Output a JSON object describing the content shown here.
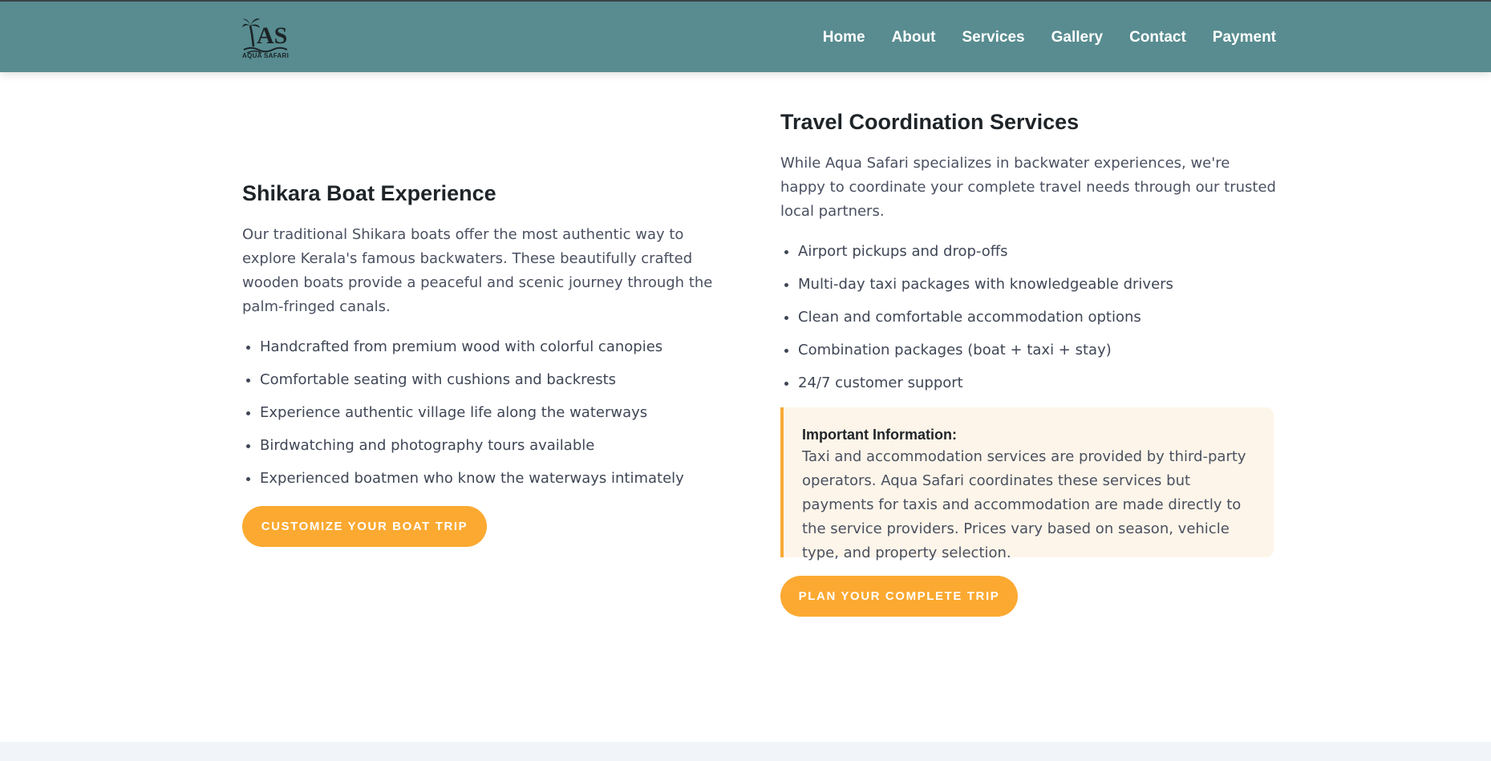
{
  "brand": {
    "logo_letters": "AS",
    "logo_text": "AQUA SAFARI"
  },
  "nav": {
    "items": [
      "Home",
      "About",
      "Services",
      "Gallery",
      "Contact",
      "Payment"
    ]
  },
  "shikara": {
    "title": "Shikara Boat Experience",
    "description": "Our traditional Shikara boats offer the most authentic way to explore Kerala's famous backwaters. These beautifully crafted wooden boats provide a peaceful and scenic journey through the palm-fringed canals.",
    "features": [
      "Handcrafted from premium wood with colorful canopies",
      "Comfortable seating with cushions and backrests",
      "Experience authentic village life along the waterways",
      "Birdwatching and photography tours available",
      "Experienced boatmen who know the waterways intimately"
    ],
    "cta": "Customize Your Boat Trip"
  },
  "travel": {
    "title": "Travel Coordination Services",
    "description": "While Aqua Safari specializes in backwater experiences, we're happy to coordinate your complete travel needs through our trusted local partners.",
    "features": [
      "Airport pickups and drop-offs",
      "Multi-day taxi packages with knowledgeable drivers",
      "Clean and comfortable accommodation options",
      "Combination packages (boat + taxi + stay)",
      "24/7 customer support"
    ],
    "notice_title": "Important Information:",
    "notice_body": "Taxi and accommodation services are provided by third-party operators. Aqua Safari coordinates these services but payments for taxis and accommodation are made directly to the service providers. Prices vary based on season, vehicle type, and property selection.",
    "cta": "Plan Your Complete Trip"
  },
  "colors": {
    "header": "#588c90",
    "accent": "#fba931",
    "notice_bg": "#fdf5e9"
  }
}
